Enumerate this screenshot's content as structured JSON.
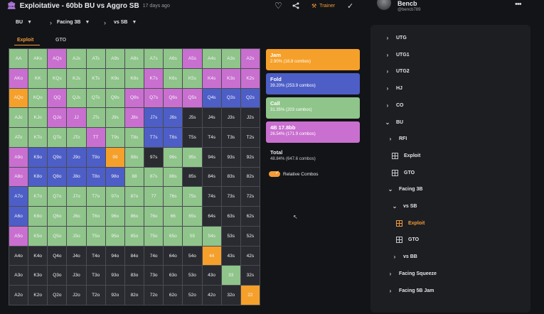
{
  "header": {
    "title": "Exploitative - 60bb BU vs Aggro SB",
    "time_ago": "17 days ago",
    "trainer_label": "Trainer"
  },
  "user": {
    "name": "Bencb",
    "handle": "@bencb789"
  },
  "selectors": [
    {
      "label": "BU"
    },
    {
      "label": "Facing 3B"
    },
    {
      "label": "vs SB"
    }
  ],
  "tabs": [
    {
      "label": "Exploit"
    },
    {
      "label": "GTO"
    }
  ],
  "colors": {
    "jam": "#f5a02a",
    "fold": "#4d5ec7",
    "call": "#8fc48a",
    "bet": "#c96fd0",
    "accent": "#f29b38"
  },
  "legend": [
    {
      "name": "Jam",
      "stat": "2.90% (18.8 combos)",
      "color": "#f5a02a"
    },
    {
      "name": "Fold",
      "stat": "39.20% (253.9 combos)",
      "color": "#4d5ec7"
    },
    {
      "name": "Call",
      "stat": "31.35% (203 combos)",
      "color": "#8fc48a"
    },
    {
      "name": "4B 17.8bb",
      "stat": "26.54% (171.9 combos)",
      "color": "#c96fd0"
    }
  ],
  "total": {
    "label": "Total",
    "stat": "48.84% (647.6 combos)"
  },
  "relative_combos_label": "Relative Combos",
  "hand_grid": [
    [
      "AA",
      "AKs",
      "AQs",
      "AJs",
      "ATs",
      "A9s",
      "A8s",
      "A7s",
      "A6s",
      "A5s",
      "A4s",
      "A3s",
      "A2s"
    ],
    [
      "AKo",
      "KK",
      "KQs",
      "KJs",
      "KTs",
      "K9s",
      "K8s",
      "K7s",
      "K6s",
      "K5s",
      "K4s",
      "K3s",
      "K2s"
    ],
    [
      "AQo",
      "KQo",
      "QQ",
      "QJs",
      "QTs",
      "Q9s",
      "Q8s",
      "Q7s",
      "Q6s",
      "Q5s",
      "Q4s",
      "Q3s",
      "Q2s"
    ],
    [
      "AJo",
      "KJo",
      "QJo",
      "JJ",
      "JTs",
      "J9s",
      "J8s",
      "J7s",
      "J6s",
      "J5s",
      "J4s",
      "J3s",
      "J2s"
    ],
    [
      "ATo",
      "KTo",
      "QTo",
      "JTo",
      "TT",
      "T9s",
      "T8s",
      "T7s",
      "T6s",
      "T5s",
      "T4s",
      "T3s",
      "T2s"
    ],
    [
      "A9o",
      "K9o",
      "Q9o",
      "J9o",
      "T9o",
      "99",
      "98s",
      "97s",
      "96s",
      "95s",
      "94s",
      "93s",
      "92s"
    ],
    [
      "A8o",
      "K8o",
      "Q8o",
      "J8o",
      "T8o",
      "98o",
      "88",
      "87s",
      "86s",
      "85s",
      "84s",
      "83s",
      "82s"
    ],
    [
      "A7o",
      "K7o",
      "Q7o",
      "J7o",
      "T7o",
      "97o",
      "87o",
      "77",
      "76s",
      "75s",
      "74s",
      "73s",
      "72s"
    ],
    [
      "A6o",
      "K6o",
      "Q6o",
      "J6o",
      "T6o",
      "96o",
      "86o",
      "76o",
      "66",
      "65s",
      "64s",
      "63s",
      "62s"
    ],
    [
      "A5o",
      "K5o",
      "Q5o",
      "J5o",
      "T5o",
      "95o",
      "85o",
      "75o",
      "65o",
      "55",
      "54s",
      "53s",
      "52s"
    ],
    [
      "A4o",
      "K4o",
      "Q4o",
      "J4o",
      "T4o",
      "94o",
      "84o",
      "74o",
      "64o",
      "54o",
      "44",
      "43s",
      "42s"
    ],
    [
      "A3o",
      "K3o",
      "Q3o",
      "J3o",
      "T3o",
      "93o",
      "83o",
      "73o",
      "63o",
      "53o",
      "43o",
      "33",
      "32s"
    ],
    [
      "A2o",
      "K2o",
      "Q2o",
      "J2o",
      "T2o",
      "92o",
      "82o",
      "72o",
      "62o",
      "52o",
      "42o",
      "32o",
      "22"
    ]
  ],
  "tree": [
    {
      "label": "UTG",
      "arrow": "›",
      "icon": "none"
    },
    {
      "label": "UTG1",
      "arrow": "›",
      "icon": "none"
    },
    {
      "label": "UTG2",
      "arrow": "›",
      "icon": "none"
    },
    {
      "label": "HJ",
      "arrow": "›",
      "icon": "none"
    },
    {
      "label": "CO",
      "arrow": "›",
      "icon": "none"
    },
    {
      "label": "BU",
      "arrow": "⌄",
      "icon": "none"
    },
    {
      "label": "RFI",
      "arrow": "›",
      "icon": "none"
    },
    {
      "label": "Exploit",
      "arrow": "",
      "icon": "grid"
    },
    {
      "label": "GTO",
      "arrow": "",
      "icon": "grid"
    },
    {
      "label": "Facing 3B",
      "arrow": "⌄",
      "icon": "none"
    },
    {
      "label": "vs SB",
      "arrow": "⌄",
      "icon": "none"
    },
    {
      "label": "Exploit",
      "arrow": "",
      "icon": "grid-active"
    },
    {
      "label": "GTO",
      "arrow": "",
      "icon": "grid"
    },
    {
      "label": "vs BB",
      "arrow": "›",
      "icon": "none"
    },
    {
      "label": "Facing Squeeze",
      "arrow": "›",
      "icon": "none"
    },
    {
      "label": "Facing 5B Jam",
      "arrow": "›",
      "icon": "none"
    }
  ]
}
